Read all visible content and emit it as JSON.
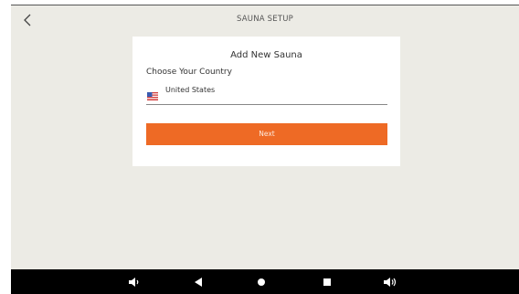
{
  "header": {
    "title": "SAUNA SETUP",
    "back_icon": "chevron-left-icon"
  },
  "card": {
    "title": "Add New Sauna",
    "country_label": "Choose Your Country",
    "selected_country": "United States",
    "flag_icon": "us-flag-icon",
    "next_label": "Next"
  },
  "colors": {
    "accent": "#ee6a25",
    "background": "#ecebe5",
    "card": "#ffffff",
    "navbar": "#000000"
  },
  "navbar": {
    "icons": [
      "volume-down-icon",
      "back-triangle-icon",
      "home-circle-icon",
      "recents-square-icon",
      "volume-up-icon"
    ]
  }
}
